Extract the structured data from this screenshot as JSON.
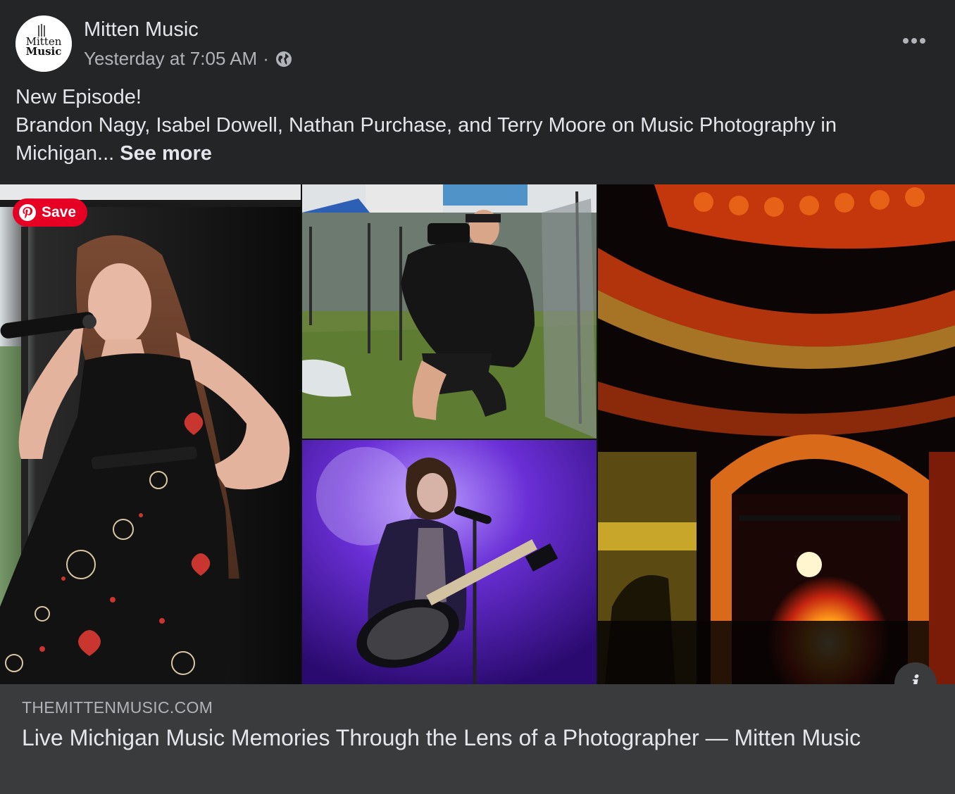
{
  "post": {
    "page_name": "Mitten Music",
    "avatar_text": "Mitten Music",
    "timestamp": "Yesterday at 7:05 AM",
    "separator": "·",
    "privacy_icon": "globe-icon",
    "more_icon": "more-horizontal-icon",
    "text_line_1": "New Episode!",
    "text_line_2": "Brandon Nagy, Isabel Dowell, Nathan Purchase, and Terry Moore on Music Photography in",
    "text_line_3": "Michigan...",
    "see_more_label": "See more"
  },
  "pinterest": {
    "save_label": "Save",
    "icon": "pinterest-icon",
    "color": "#e60023"
  },
  "info_button": {
    "glyph": "i",
    "icon": "info-icon"
  },
  "link_preview": {
    "domain": "THEMITTENMUSIC.COM",
    "title": "Live Michigan Music Memories Through the Lens of a Photographer — Mitten Music"
  },
  "colors": {
    "background": "#242526",
    "card": "#3a3b3c",
    "text_primary": "#e4e6eb",
    "text_secondary": "#b0b3b8"
  }
}
